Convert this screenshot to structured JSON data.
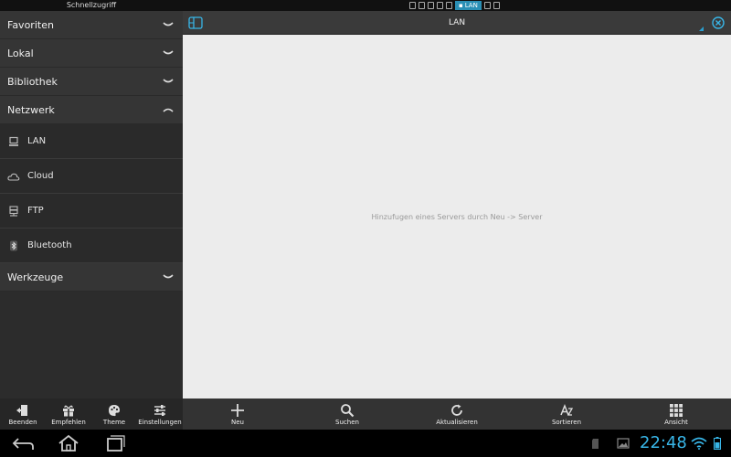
{
  "top": {
    "quick_access": "Schnellzugriff",
    "active_tab": "LAN"
  },
  "sidebar": {
    "sections": [
      {
        "label": "Favoriten",
        "expanded": false
      },
      {
        "label": "Lokal",
        "expanded": false
      },
      {
        "label": "Bibliothek",
        "expanded": false
      },
      {
        "label": "Netzwerk",
        "expanded": true
      },
      {
        "label": "Werkzeuge",
        "expanded": false
      }
    ],
    "network_items": [
      {
        "label": "LAN",
        "icon": "computer-icon"
      },
      {
        "label": "Cloud",
        "icon": "cloud-icon"
      },
      {
        "label": "FTP",
        "icon": "ftp-server-icon"
      },
      {
        "label": "Bluetooth",
        "icon": "bluetooth-icon"
      }
    ]
  },
  "pathbar": {
    "title": "LAN"
  },
  "content": {
    "empty_message": "Hinzufugen eines Servers durch Neu -> Server"
  },
  "left_toolbar": [
    {
      "label": "Beenden",
      "icon": "exit-icon"
    },
    {
      "label": "Empfehlen",
      "icon": "gift-icon"
    },
    {
      "label": "Theme",
      "icon": "palette-icon"
    },
    {
      "label": "Einstellungen",
      "icon": "sliders-icon"
    }
  ],
  "main_toolbar": [
    {
      "label": "Neu",
      "icon": "plus-icon"
    },
    {
      "label": "Suchen",
      "icon": "search-icon"
    },
    {
      "label": "Aktualisieren",
      "icon": "refresh-icon"
    },
    {
      "label": "Sortieren",
      "icon": "sort-icon"
    },
    {
      "label": "Ansicht",
      "icon": "grid-icon"
    }
  ],
  "status": {
    "time": "22:48"
  },
  "colors": {
    "accent": "#38b6e8",
    "content_bg": "#ececec",
    "sidebar_bg": "#2c2c2c"
  }
}
